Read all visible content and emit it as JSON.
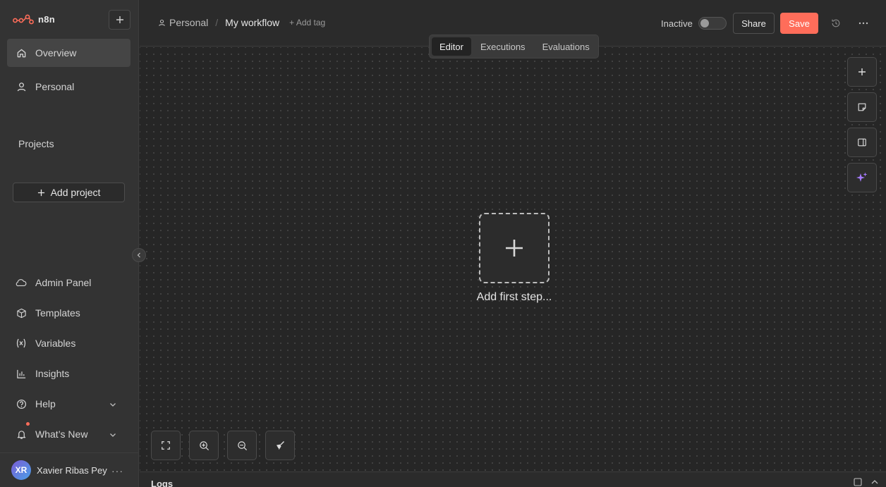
{
  "app": {
    "logo_text": "n8n"
  },
  "sidebar": {
    "top_items": [
      {
        "label": "Overview",
        "icon": "home-icon",
        "active": true
      },
      {
        "label": "Personal",
        "icon": "user-icon",
        "active": false
      }
    ],
    "projects_title": "Projects",
    "add_project_label": "Add project",
    "bottom_items": [
      {
        "label": "Admin Panel",
        "icon": "cloud-icon"
      },
      {
        "label": "Templates",
        "icon": "box-icon"
      },
      {
        "label": "Variables",
        "icon": "variables-icon"
      },
      {
        "label": "Insights",
        "icon": "bar-chart-icon"
      },
      {
        "label": "Help",
        "icon": "help-circle-icon"
      },
      {
        "label": "What’s New",
        "icon": "bell-icon"
      }
    ],
    "user": {
      "initials": "XR",
      "name": "Xavier Ribas Pey"
    }
  },
  "header": {
    "project": "Personal",
    "separator": "/",
    "workflow_title": "My workflow",
    "add_tag": "+ Add tag",
    "status_label": "Inactive",
    "share_label": "Share",
    "save_label": "Save",
    "tabs": [
      {
        "label": "Editor",
        "active": true
      },
      {
        "label": "Executions",
        "active": false
      },
      {
        "label": "Evaluations",
        "active": false
      }
    ]
  },
  "canvas": {
    "add_first_step_label": "Add first step..."
  },
  "logs": {
    "label": "Logs"
  },
  "colors": {
    "accent": "#ff6d5a",
    "ai_accent": "#a57bff",
    "canvas_bg": "#262626",
    "sidebar_bg": "#333333"
  }
}
